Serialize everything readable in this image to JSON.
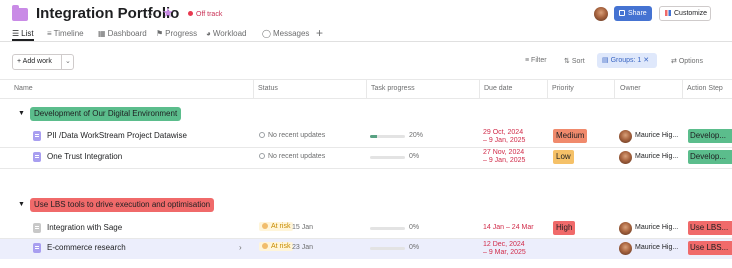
{
  "header": {
    "title": "Integration Portfolio",
    "status": "Off track",
    "share_label": "Share",
    "customize_label": "Customize"
  },
  "tabs": [
    {
      "label": "List",
      "icon": "list-icon"
    },
    {
      "label": "Timeline",
      "icon": "timeline-icon"
    },
    {
      "label": "Dashboard",
      "icon": "dashboard-icon"
    },
    {
      "label": "Progress",
      "icon": "progress-icon"
    },
    {
      "label": "Workload",
      "icon": "workload-icon"
    },
    {
      "label": "Messages",
      "icon": "messages-icon"
    }
  ],
  "toolbar": {
    "add_work": "Add work",
    "filter": "Filter",
    "sort": "Sort",
    "groups": "Groups: 1",
    "options": "Options"
  },
  "columns": [
    "Name",
    "Status",
    "Task progress",
    "Due date",
    "Priority",
    "Owner",
    "Action Step"
  ],
  "sections": [
    {
      "label": "Development of Our Digital Environment",
      "color": "#5bbd8c",
      "rows": [
        {
          "name": "PII /Data WorkStream Project Datawise",
          "status": "No recent updates",
          "status_date": "",
          "progress": 20,
          "progress_label": "20%",
          "due_line1": "29 Oct, 2024",
          "due_line2": "– 9 Jan, 2025",
          "priority": "Medium",
          "priority_color": "#f08a6c",
          "owner": "Maurice Hig...",
          "action": "Develop...",
          "action_color": "#5bbd8c"
        },
        {
          "name": "One Trust Integration",
          "status": "No recent updates",
          "status_date": "",
          "progress": 0,
          "progress_label": "0%",
          "due_line1": "27 Nov, 2024",
          "due_line2": "– 9 Jan, 2025",
          "priority": "Low",
          "priority_color": "#f5c168",
          "owner": "Maurice Hig...",
          "action": "Develop...",
          "action_color": "#5bbd8c"
        }
      ]
    },
    {
      "label": "Use LBS tools to drive execution and optimisation",
      "color": "#f06a6a",
      "rows": [
        {
          "name": "Integration with Sage",
          "status": "At risk",
          "status_date": "15 Jan",
          "progress": 0,
          "progress_label": "0%",
          "due_line1": "14 Jan – 24 Mar",
          "due_line2": "",
          "priority": "High",
          "priority_color": "#f06a6a",
          "owner": "Maurice Hig...",
          "action": "Use LBS...",
          "action_color": "#f06a6a"
        },
        {
          "name": "E-commerce research",
          "status": "At risk",
          "status_date": "23 Jan",
          "progress": 0,
          "progress_label": "0%",
          "due_line1": "12 Dec, 2024",
          "due_line2": "– 9 Mar, 2025",
          "priority": "",
          "priority_color": "",
          "owner": "Maurice Hig...",
          "action": "Use LBS...",
          "action_color": "#f06a6a"
        }
      ]
    }
  ]
}
